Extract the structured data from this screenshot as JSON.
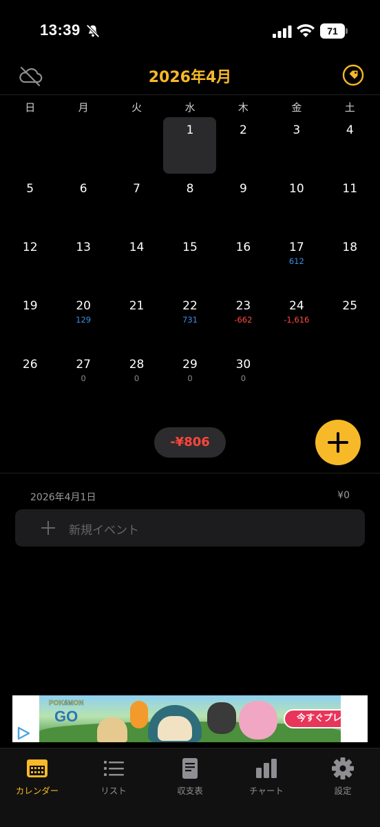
{
  "status_bar": {
    "time": "13:39",
    "battery": "71"
  },
  "header": {
    "month_title": "2026年4月",
    "accent_color": "#f7b928",
    "left_icon": "cloud-off-icon",
    "right_icon": "tag-icon"
  },
  "calendar": {
    "weekdays": [
      "日",
      "月",
      "火",
      "水",
      "木",
      "金",
      "土"
    ],
    "weeks": [
      [
        {
          "day": "",
          "amount": ""
        },
        {
          "day": "",
          "amount": ""
        },
        {
          "day": "",
          "amount": ""
        },
        {
          "day": "1",
          "amount": "",
          "selected": true
        },
        {
          "day": "2",
          "amount": ""
        },
        {
          "day": "3",
          "amount": ""
        },
        {
          "day": "4",
          "amount": ""
        }
      ],
      [
        {
          "day": "5",
          "amount": ""
        },
        {
          "day": "6",
          "amount": ""
        },
        {
          "day": "7",
          "amount": ""
        },
        {
          "day": "8",
          "amount": ""
        },
        {
          "day": "9",
          "amount": ""
        },
        {
          "day": "10",
          "amount": ""
        },
        {
          "day": "11",
          "amount": ""
        }
      ],
      [
        {
          "day": "12",
          "amount": ""
        },
        {
          "day": "13",
          "amount": ""
        },
        {
          "day": "14",
          "amount": ""
        },
        {
          "day": "15",
          "amount": ""
        },
        {
          "day": "16",
          "amount": ""
        },
        {
          "day": "17",
          "amount": "612",
          "sign": "pos"
        },
        {
          "day": "18",
          "amount": ""
        }
      ],
      [
        {
          "day": "19",
          "amount": ""
        },
        {
          "day": "20",
          "amount": "129",
          "sign": "pos"
        },
        {
          "day": "21",
          "amount": ""
        },
        {
          "day": "22",
          "amount": "731",
          "sign": "pos"
        },
        {
          "day": "23",
          "amount": "-662",
          "sign": "neg"
        },
        {
          "day": "24",
          "amount": "-1,616",
          "sign": "neg"
        },
        {
          "day": "25",
          "amount": ""
        }
      ],
      [
        {
          "day": "26",
          "amount": ""
        },
        {
          "day": "27",
          "amount": "0",
          "sign": "zero"
        },
        {
          "day": "28",
          "amount": "0",
          "sign": "zero"
        },
        {
          "day": "29",
          "amount": "0",
          "sign": "zero"
        },
        {
          "day": "30",
          "amount": "0",
          "sign": "zero"
        },
        {
          "day": "",
          "amount": ""
        },
        {
          "day": "",
          "amount": ""
        }
      ]
    ],
    "colors": {
      "positive": "#3b8fe6",
      "negative": "#ff4b3e",
      "zero": "#8c8c8c"
    }
  },
  "summary": {
    "month_total": "-¥806"
  },
  "selected_day": {
    "date_label": "2026年4月1日",
    "total": "¥0",
    "new_event_placeholder": "新規イベント"
  },
  "ad": {
    "logo_line1": "POKéMON",
    "logo_line2": "GO",
    "cta": "今すぐプレイ"
  },
  "tabbar": {
    "tabs": [
      {
        "label": "カレンダー",
        "icon": "calendar-icon",
        "active": true
      },
      {
        "label": "リスト",
        "icon": "list-icon"
      },
      {
        "label": "収支表",
        "icon": "document-icon"
      },
      {
        "label": "チャート",
        "icon": "bar-chart-icon"
      },
      {
        "label": "設定",
        "icon": "gear-icon"
      }
    ]
  }
}
